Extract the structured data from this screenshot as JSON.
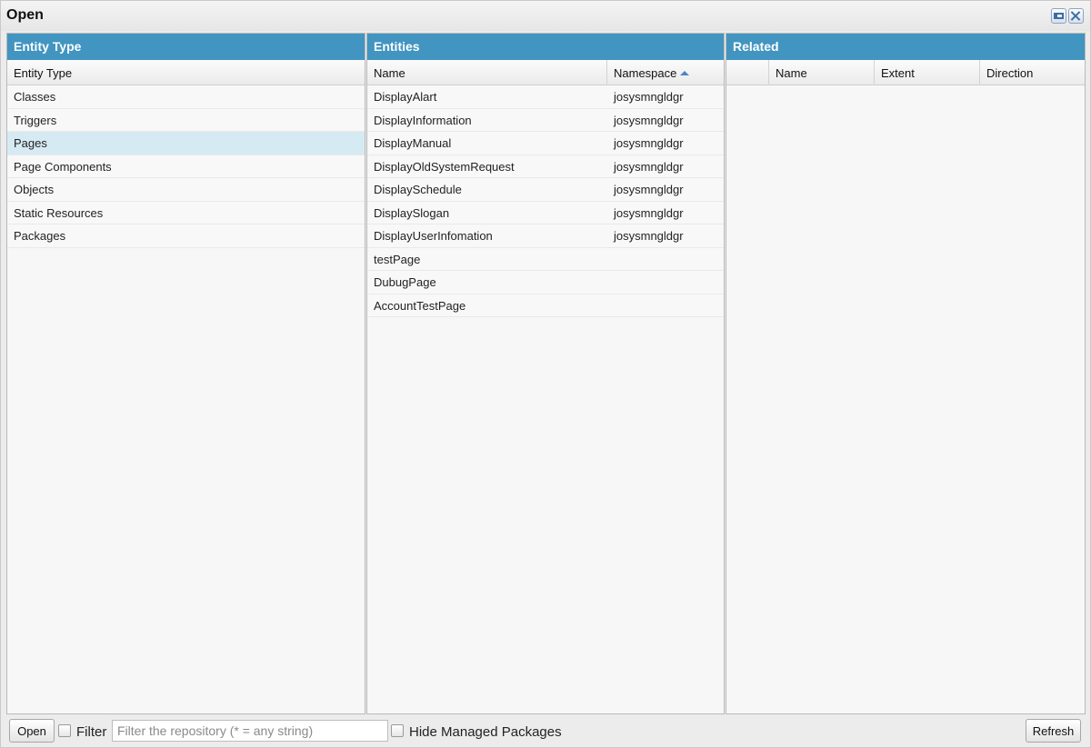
{
  "window": {
    "title": "Open"
  },
  "entity_type_panel": {
    "header": "Entity Type",
    "column": "Entity Type",
    "items": [
      "Classes",
      "Triggers",
      "Pages",
      "Page Components",
      "Objects",
      "Static Resources",
      "Packages"
    ],
    "selected": "Pages"
  },
  "entities_panel": {
    "header": "Entities",
    "columns": {
      "name": "Name",
      "namespace": "Namespace"
    },
    "sort": "namespace-ascending",
    "rows": [
      {
        "name": "DisplayAlart",
        "namespace": "josysmngldgr"
      },
      {
        "name": "DisplayInformation",
        "namespace": "josysmngldgr"
      },
      {
        "name": "DisplayManual",
        "namespace": "josysmngldgr"
      },
      {
        "name": "DisplayOldSystemRequest",
        "namespace": "josysmngldgr"
      },
      {
        "name": "DisplaySchedule",
        "namespace": "josysmngldgr"
      },
      {
        "name": "DisplaySlogan",
        "namespace": "josysmngldgr"
      },
      {
        "name": "DisplayUserInfomation",
        "namespace": "josysmngldgr"
      },
      {
        "name": "testPage",
        "namespace": ""
      },
      {
        "name": "DubugPage",
        "namespace": ""
      },
      {
        "name": "AccountTestPage",
        "namespace": ""
      }
    ]
  },
  "related_panel": {
    "header": "Related",
    "columns": [
      "",
      "Name",
      "Extent",
      "Direction"
    ]
  },
  "footer": {
    "open_label": "Open",
    "filter_label": "Filter",
    "filter_placeholder": "Filter the repository (* = any string)",
    "filter_value": "",
    "hide_managed_label": "Hide Managed Packages",
    "refresh_label": "Refresh"
  },
  "colors": {
    "panel_header": "#4295c0",
    "selected_row": "#d6eaf3"
  }
}
